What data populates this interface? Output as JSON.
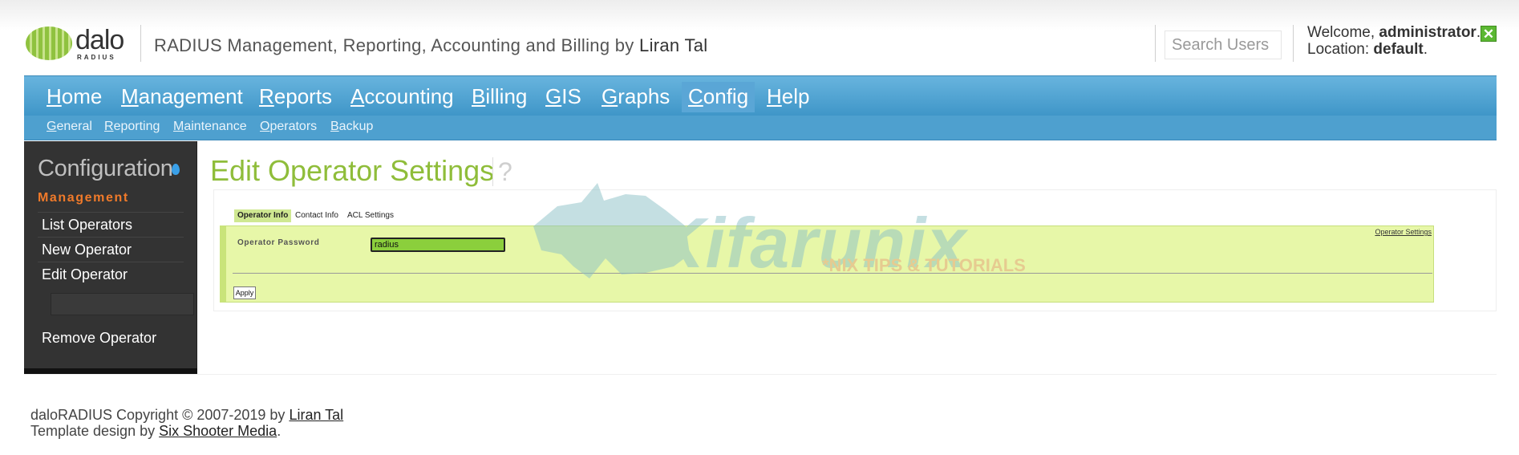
{
  "header": {
    "logo_text": "dalo",
    "logo_subtext": "RADIUS",
    "title": "RADIUS Management, Reporting, Accounting and Billing by",
    "author": "Liran Tal",
    "search_placeholder": "Search Users",
    "welcome_prefix": "Welcome,",
    "user": "administrator",
    "location_prefix": "Location:",
    "location": "default"
  },
  "nav": {
    "items": [
      {
        "first": "H",
        "rest": "ome"
      },
      {
        "first": "M",
        "rest": "anagement"
      },
      {
        "first": "R",
        "rest": "eports"
      },
      {
        "first": "A",
        "rest": "ccounting"
      },
      {
        "first": "B",
        "rest": "illing"
      },
      {
        "first": "G",
        "rest": "IS"
      },
      {
        "first": "G",
        "rest": "raphs"
      },
      {
        "first": "C",
        "rest": "onfig"
      },
      {
        "first": "H",
        "rest": "elp"
      }
    ],
    "active_index": 7,
    "sub_items": [
      {
        "first": "G",
        "rest": "eneral"
      },
      {
        "first": "R",
        "rest": "eporting"
      },
      {
        "first": "M",
        "rest": "aintenance"
      },
      {
        "first": "O",
        "rest": "perators"
      },
      {
        "first": "B",
        "rest": "ackup"
      }
    ]
  },
  "sidebar": {
    "title": "Configuration",
    "section": "Management",
    "items": [
      "List Operators",
      "New Operator",
      "Edit Operator",
      "Remove Operator"
    ],
    "edit_operator_value": ""
  },
  "main": {
    "title": "Edit Operator Settings",
    "help_mark": "?",
    "tabs": [
      "Operator Info",
      "Contact Info",
      "ACL Settings"
    ],
    "active_tab": 0,
    "settings_link": "Operator Settings",
    "password_label": "Operator Password",
    "password_value": "radius",
    "apply_label": "Apply"
  },
  "watermark": {
    "text": "Kifarunix",
    "subtext": "*NIX TIPS & TUTORIALS"
  },
  "footer": {
    "copyright_prefix": "daloRADIUS Copyright © 2007-2019 by",
    "copyright_author": "Liran Tal",
    "design_prefix": "Template design by",
    "designer": "Six Shooter Media"
  },
  "colors": {
    "nav_blue": "#4ea0cf",
    "title_green": "#8fbd3a",
    "section_orange": "#f07a2a",
    "form_bg": "#e7f7a8",
    "sidebar_bg": "#333333"
  }
}
